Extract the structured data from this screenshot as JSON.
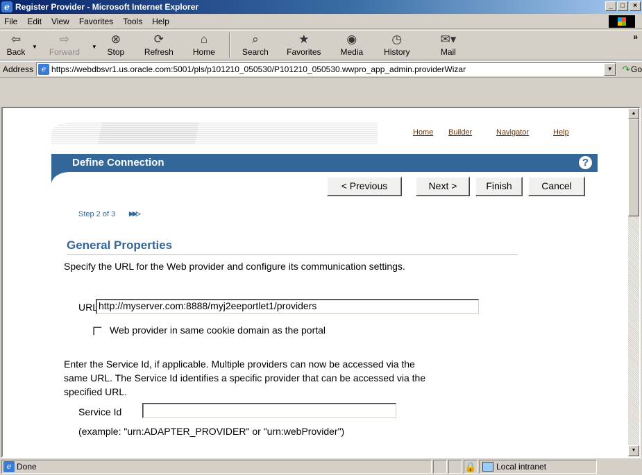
{
  "window": {
    "title": "Register Provider - Microsoft Internet Explorer"
  },
  "menu": [
    "File",
    "Edit",
    "View",
    "Favorites",
    "Tools",
    "Help"
  ],
  "toolbar": {
    "back": "Back",
    "forward": "Forward",
    "stop": "Stop",
    "refresh": "Refresh",
    "home": "Home",
    "search": "Search",
    "favorites": "Favorites",
    "media": "Media",
    "history": "History",
    "mail": "Mail"
  },
  "address": {
    "label": "Address",
    "url": "https://webdbsvr1.us.oracle.com:5001/pls/p101210_050530/P101210_050530.wwpro_app_admin.providerWizar",
    "go": "Go"
  },
  "page": {
    "links": {
      "home": "Home",
      "builder": "Builder",
      "navigator": "Navigator",
      "help": "Help"
    },
    "header_title": "Define Connection",
    "help_glyph": "?",
    "buttons": {
      "previous": "< Previous",
      "next": "Next >",
      "finish": "Finish",
      "cancel": "Cancel"
    },
    "step": "Step 2 of 3",
    "section_title": "General Properties",
    "intro": "Specify the URL for the Web provider and configure its communication settings.",
    "url_label": "URL",
    "url_value": "http://myserver.com:8888/myj2eeportlet1/providers",
    "cookie_label": "Web provider in same cookie domain as the portal",
    "service_text_1": "Enter the Service Id, if applicable. Multiple providers can now be accessed via the",
    "service_text_2": "same URL. The Service Id identifies a specific provider that can be accessed via the",
    "service_text_3": "specified URL.",
    "service_label": "Service Id",
    "service_value": "",
    "example": "(example: \"urn:ADAPTER_PROVIDER\" or \"urn:webProvider\")"
  },
  "status": {
    "text": "Done",
    "zone": "Local intranet"
  }
}
